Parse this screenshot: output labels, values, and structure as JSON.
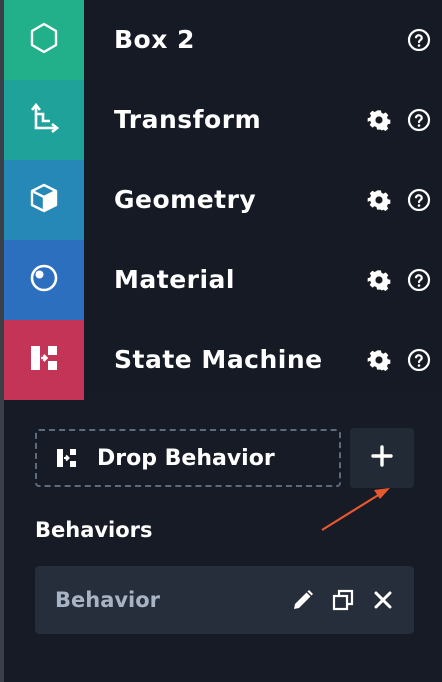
{
  "colors": {
    "box": "#21b089",
    "transform": "#1fa29a",
    "geometry": "#2588b6",
    "material": "#2c6fbf",
    "state_machine": "#c33456",
    "arrow": "#e8582f"
  },
  "rows": [
    {
      "label": "Box 2",
      "icon": "hexagon-icon",
      "has_gear": false,
      "has_help": true
    },
    {
      "label": "Transform",
      "icon": "transform-axes-icon",
      "has_gear": true,
      "has_help": true
    },
    {
      "label": "Geometry",
      "icon": "cube-icon",
      "has_gear": true,
      "has_help": true
    },
    {
      "label": "Material",
      "icon": "material-sphere-icon",
      "has_gear": true,
      "has_help": true
    },
    {
      "label": "State Machine",
      "icon": "state-machine-icon",
      "has_gear": true,
      "has_help": true
    }
  ],
  "drop_zone": {
    "label": "Drop Behavior",
    "icon": "behavior-icon"
  },
  "add_button": {
    "icon": "plus-icon"
  },
  "behaviors": {
    "title": "Behaviors",
    "items": [
      {
        "name": "Behavior",
        "actions": [
          "edit-icon",
          "duplicate-icon",
          "close-icon"
        ]
      }
    ]
  }
}
